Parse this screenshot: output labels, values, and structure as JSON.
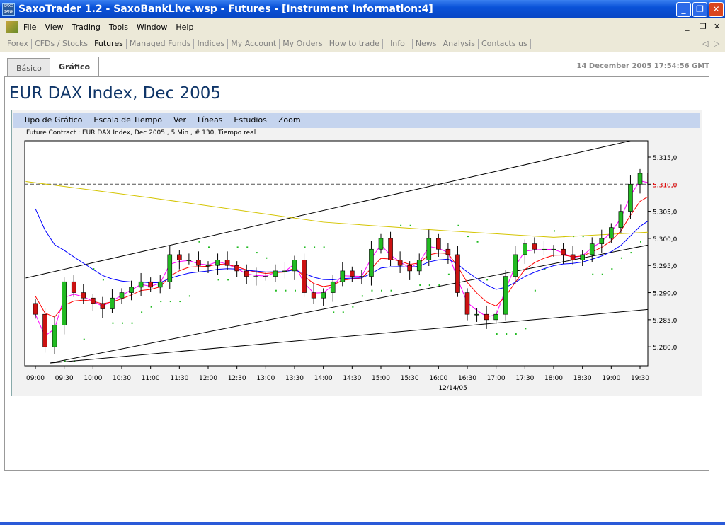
{
  "window": {
    "title": "SaxoTrader 1.2 - SaxoBankLive.wsp - Futures - [Instrument Information:4]",
    "logo": "SAXO BANK"
  },
  "menu": [
    "File",
    "View",
    "Trading",
    "Tools",
    "Window",
    "Help"
  ],
  "nav": [
    "Forex",
    "CFDs / Stocks",
    "Futures",
    "Managed Funds",
    "Indices",
    "My Account",
    "My Orders",
    "How to trade",
    "Info",
    "News",
    "Analysis",
    "Contacts us"
  ],
  "tabs": [
    "Básico",
    "Gráfico"
  ],
  "timestamp": "14 December 2005 17:54:56 GMT",
  "page_title": "EUR DAX Index, Dec 2005",
  "chart_menu": [
    "Tipo de Gráfico",
    "Escala de Tiempo",
    "Ver",
    "Líneas",
    "Estudios",
    "Zoom"
  ],
  "chart_subtitle": "Future Contract : EUR DAX Index, Dec 2005 , 5 Min , # 130, Tiempo real",
  "chart_data": {
    "type": "candlestick",
    "interval_minutes": 10,
    "start": "09:00",
    "closes": [
      5286,
      5280,
      5284,
      5292,
      5290,
      5289,
      5288,
      5287,
      5289,
      5290,
      5291,
      5292,
      5291,
      5292,
      5297,
      5296,
      5296,
      5295,
      5295,
      5296,
      5295,
      5294,
      5293,
      5293,
      5293,
      5294,
      5294,
      5296,
      5290,
      5289,
      5290,
      5292,
      5294,
      5293,
      5293,
      5298,
      5300,
      5296,
      5295,
      5294,
      5296,
      5300,
      5298,
      5297,
      5290,
      5286,
      5286,
      5285,
      5286,
      5293,
      5297,
      5299,
      5298,
      5298,
      5298,
      5297,
      5296,
      5297,
      5299,
      5300,
      5302,
      5305,
      5310,
      5312,
      5310,
      5310
    ],
    "yaxis": {
      "min": 5276.5,
      "max": 5318,
      "ticks": [
        5280,
        5285,
        5290,
        5295,
        5300,
        5305,
        5310,
        5315
      ],
      "labels": [
        "5.280,0",
        "5.285,0",
        "5.290,0",
        "5.295,0",
        "5.300,0",
        "5.305,0",
        "5.310,0",
        "5.315,0"
      ]
    },
    "xaxis": {
      "ticks": [
        "09:00",
        "09:30",
        "10:00",
        "10:30",
        "11:00",
        "11:30",
        "12:00",
        "12:30",
        "13:00",
        "13:30",
        "14:00",
        "14:30",
        "15:00",
        "15:30",
        "16:00",
        "16:30",
        "17:00",
        "17:30",
        "18:00",
        "18:30",
        "19:00",
        "19:30"
      ],
      "date_label": "12/14/05"
    },
    "last_price": 5310,
    "last_label": "5.310,0",
    "trendlines": [
      {
        "from": [
          -10,
          5292.7
        ],
        "to": [
          620,
          5318
        ],
        "color": "#000000"
      },
      {
        "from": [
          15,
          5277
        ],
        "to": [
          645,
          5299
        ],
        "color": "#000000"
      },
      {
        "from": [
          15,
          5277
        ],
        "to": [
          645,
          5287
        ],
        "color": "#000000"
      }
    ],
    "yellow_ma": [
      [
        -10,
        5310.5
      ],
      [
        120,
        5307.5
      ],
      [
        300,
        5303
      ],
      [
        420,
        5301.5
      ],
      [
        540,
        5300.2
      ],
      [
        645,
        5301.2
      ]
    ],
    "colors": {
      "up": "#22bb22",
      "down": "#cc1111",
      "ma_fast": "#ff00ff",
      "ma_mid": "#ff0000",
      "ma_slow": "#0000ff",
      "sar": "#22bb22",
      "last": "#ff0000"
    }
  }
}
